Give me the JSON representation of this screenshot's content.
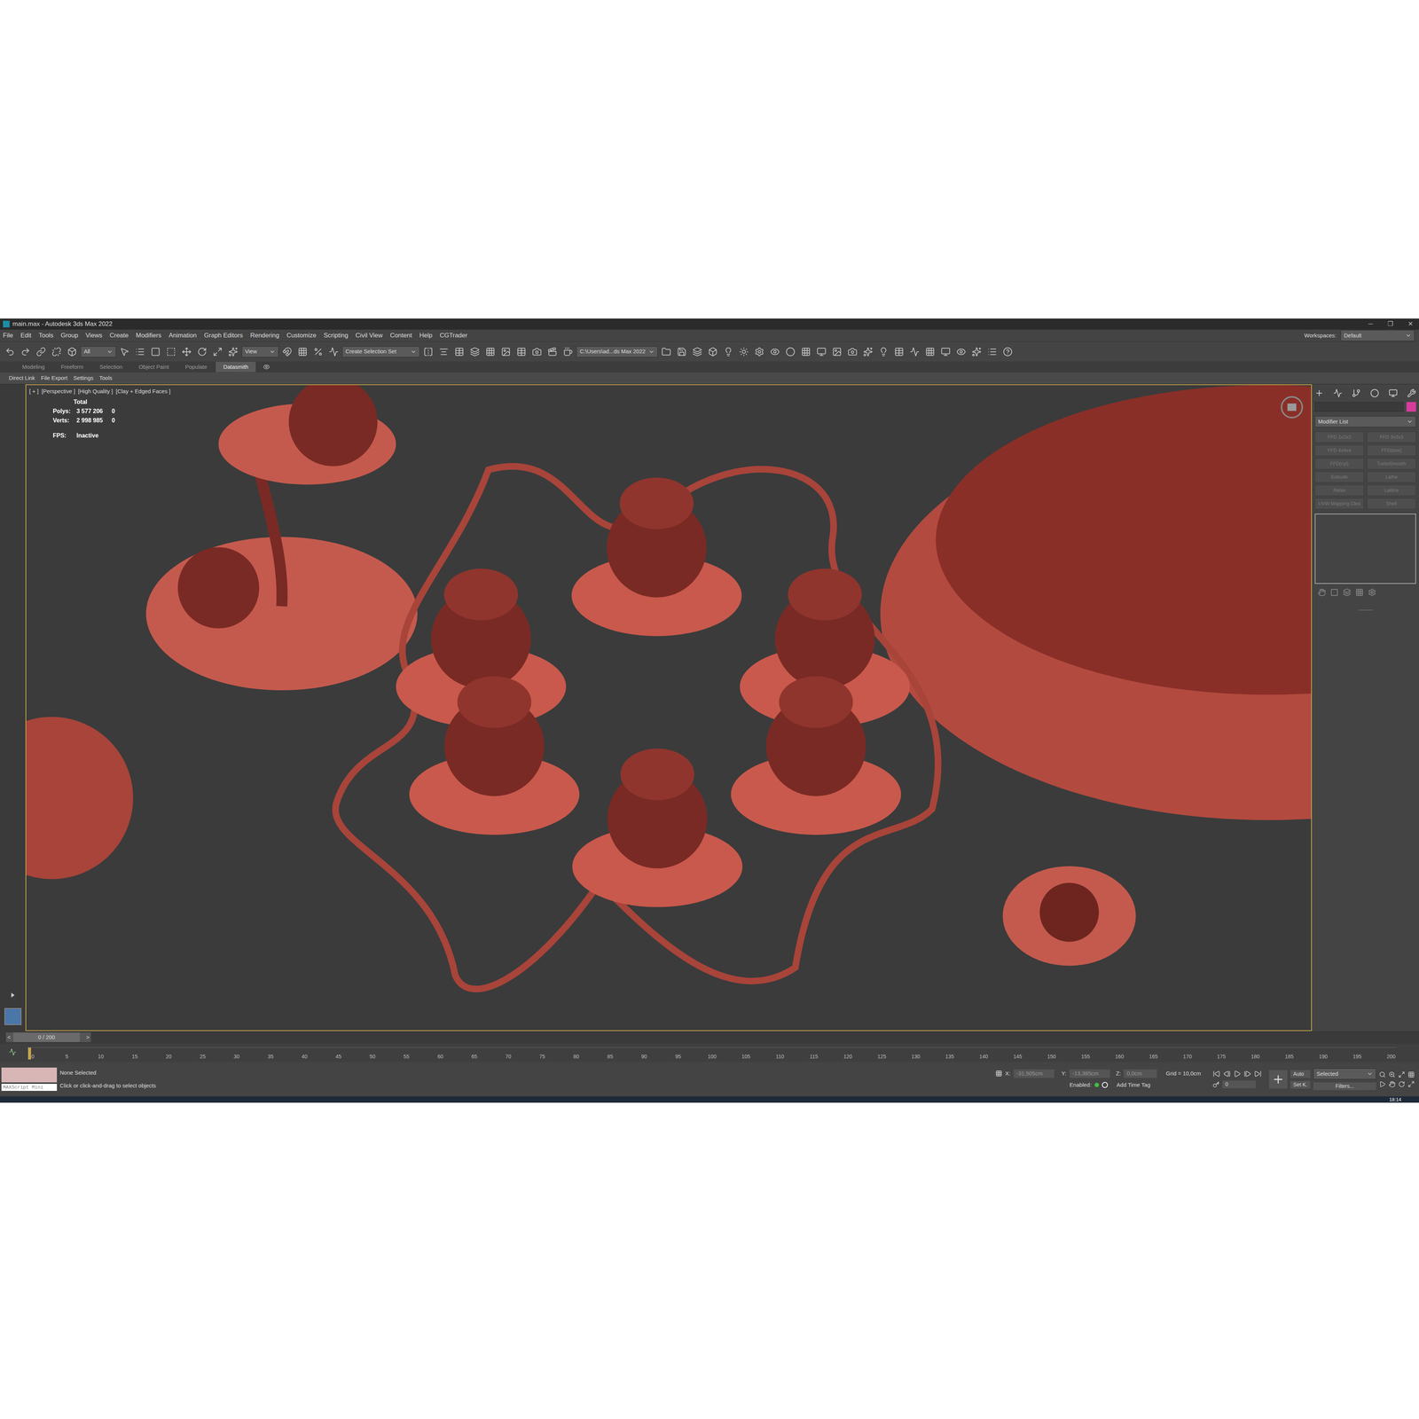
{
  "window": {
    "title": "main.max - Autodesk 3ds Max 2022",
    "controls": [
      "─",
      "❐",
      "✕"
    ]
  },
  "menu": [
    "File",
    "Edit",
    "Tools",
    "Group",
    "Views",
    "Create",
    "Modifiers",
    "Animation",
    "Graph Editors",
    "Rendering",
    "Customize",
    "Scripting",
    "Civil View",
    "Content",
    "Help",
    "CGTrader"
  ],
  "workspaces": {
    "label": "Workspaces:",
    "value": "Default"
  },
  "toolbar": {
    "selection_filter": "All",
    "reference_coord": "View",
    "selection_set": "Create Selection Set",
    "project_path": "C:\\Users\\ad...ds Max 2022"
  },
  "ribbon_tabs": [
    {
      "label": "Modeling",
      "selected": false
    },
    {
      "label": "Freeform",
      "selected": false
    },
    {
      "label": "Selection",
      "selected": false
    },
    {
      "label": "Object Paint",
      "selected": false
    },
    {
      "label": "Populate",
      "selected": false
    },
    {
      "label": "Datasmith",
      "selected": true
    }
  ],
  "datasmith_tools": [
    "Direct Link",
    "File Export",
    "Settings",
    "Tools"
  ],
  "viewport": {
    "labels": [
      "[ + ]",
      "[Perspective ]",
      "[High Quality ]",
      "[Clay + Edged Faces ]"
    ],
    "stats": {
      "header": "Total",
      "rows": [
        {
          "label": "Polys:",
          "value": "3 577 206",
          "selection": "0"
        },
        {
          "label": "Verts:",
          "value": "2 998 985",
          "selection": "0"
        }
      ]
    },
    "fps": {
      "label": "FPS:",
      "value": "Inactive"
    }
  },
  "command_panel": {
    "modifier_list": "Modifier List",
    "modifiers": [
      {
        "label": "FFD 2x2x2",
        "disabled": true
      },
      {
        "label": "FFD 3x3x3",
        "disabled": true
      },
      {
        "label": "FFD 4x4x4",
        "disabled": true
      },
      {
        "label": "FFD(box)",
        "disabled": true
      },
      {
        "label": "FFD(cyl)",
        "disabled": true
      },
      {
        "label": "TurboSmooth",
        "disabled": true
      },
      {
        "label": "Extrude",
        "disabled": true
      },
      {
        "label": "Lathe",
        "disabled": true
      },
      {
        "label": "Relax",
        "disabled": true
      },
      {
        "label": "Lattice",
        "disabled": true
      },
      {
        "label": "UVW Mapping Clea",
        "disabled": true
      },
      {
        "label": "Shell",
        "disabled": true
      }
    ]
  },
  "time_slider": {
    "frame": "0 / 200",
    "prev": "<",
    "next": ">",
    "level": 0
  },
  "track_bar": {
    "ticks": [
      "0",
      "5",
      "10",
      "15",
      "20",
      "25",
      "30",
      "35",
      "40",
      "45",
      "50",
      "55",
      "60",
      "65",
      "70",
      "75",
      "80",
      "85",
      "90",
      "95",
      "100",
      "105",
      "110",
      "115",
      "120",
      "125",
      "130",
      "135",
      "140",
      "145",
      "150",
      "155",
      "160",
      "165",
      "170",
      "175",
      "180",
      "185",
      "190",
      "195",
      "200"
    ]
  },
  "status": {
    "selection": "None Selected",
    "prompt": "Click or click-and-drag to select objects",
    "maxscript": "MAXScript Mini",
    "x_label": "X:",
    "x": "-31,505cm",
    "y_label": "Y:",
    "y": "-13,385cm",
    "z_label": "Z:",
    "z": "0,0cm",
    "grid": "Grid = 10,0cm",
    "enabled": "Enabled:",
    "time_tag": "Add Time Tag",
    "auto": "Auto",
    "key_filter": "Selected",
    "set_key": "Set K.",
    "filters": "Filters...",
    "frame_field": "0"
  },
  "taskbar": {
    "clock": "18:14"
  }
}
